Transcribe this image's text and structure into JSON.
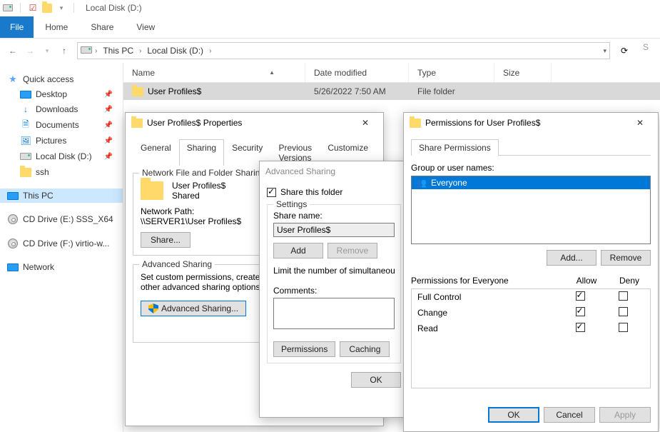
{
  "titlebar": {
    "title": "Local Disk (D:)"
  },
  "ribbon": {
    "file": "File",
    "tabs": [
      "Home",
      "Share",
      "View"
    ]
  },
  "breadcrumb": {
    "segments": [
      "This PC",
      "Local Disk (D:)"
    ]
  },
  "search": {
    "placeholder": "S"
  },
  "nav": {
    "quickaccess": "Quick access",
    "items": [
      {
        "label": "Desktop",
        "pinned": true
      },
      {
        "label": "Downloads",
        "pinned": true
      },
      {
        "label": "Documents",
        "pinned": true
      },
      {
        "label": "Pictures",
        "pinned": true
      },
      {
        "label": "Local Disk (D:)",
        "pinned": true
      },
      {
        "label": "ssh",
        "pinned": false
      }
    ],
    "thispc": "This PC",
    "drives": [
      {
        "label": "CD Drive (E:) SSS_X64"
      },
      {
        "label": "CD Drive (F:) virtio-w..."
      }
    ],
    "network": "Network"
  },
  "columns": {
    "name": "Name",
    "date": "Date modified",
    "type": "Type",
    "size": "Size"
  },
  "rows": [
    {
      "name": "User Profiles$",
      "date": "5/26/2022 7:50 AM",
      "type": "File folder",
      "size": ""
    }
  ],
  "propDlg": {
    "title": "User Profiles$ Properties",
    "tabs": [
      "General",
      "Sharing",
      "Security",
      "Previous Versions",
      "Customize"
    ],
    "nfs": {
      "legend": "Network File and Folder Sharing",
      "name": "User Profiles$",
      "status": "Shared",
      "pathLabel": "Network Path:",
      "path": "\\\\SERVER1\\User Profiles$",
      "shareBtn": "Share..."
    },
    "adv": {
      "legend": "Advanced Sharing",
      "desc": "Set custom permissions, create multiple shares, and set other advanced sharing options.",
      "btn": "Advanced Sharing..."
    }
  },
  "advDlg": {
    "title": "Advanced Sharing",
    "shareThis": "Share this folder",
    "settings": "Settings",
    "shareNameLabel": "Share name:",
    "shareName": "User Profiles$",
    "add": "Add",
    "remove": "Remove",
    "limitLabel": "Limit the number of simultaneous users to:",
    "commentsLabel": "Comments:",
    "permissions": "Permissions",
    "caching": "Caching",
    "ok": "OK"
  },
  "permDlg": {
    "title": "Permissions for User Profiles$",
    "tab": "Share Permissions",
    "groupLabel": "Group or user names:",
    "principals": [
      "Everyone"
    ],
    "addBtn": "Add...",
    "removeBtn": "Remove",
    "permForLabel": "Permissions for Everyone",
    "allow": "Allow",
    "deny": "Deny",
    "perms": [
      {
        "label": "Full Control",
        "allow": true,
        "deny": false
      },
      {
        "label": "Change",
        "allow": true,
        "deny": false
      },
      {
        "label": "Read",
        "allow": true,
        "deny": false
      }
    ],
    "ok": "OK",
    "cancel": "Cancel",
    "apply": "Apply"
  }
}
